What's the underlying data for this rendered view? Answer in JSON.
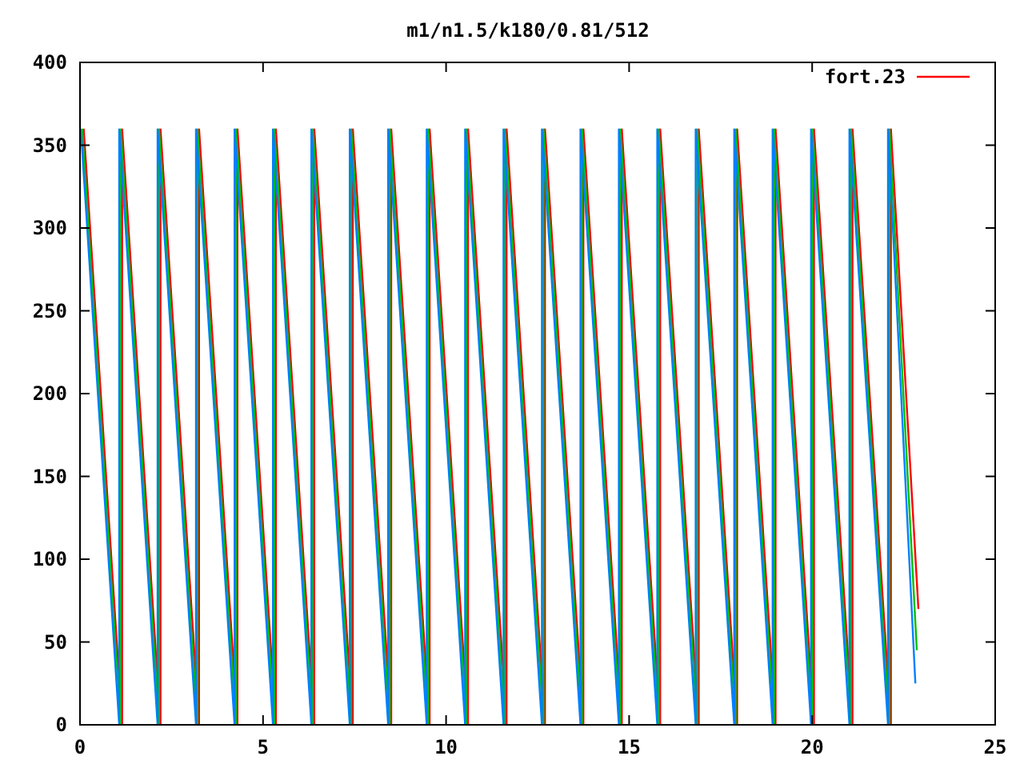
{
  "chart_data": {
    "type": "line",
    "title": "m1/n1.5/k180/0.81/512",
    "xlim": [
      0,
      25
    ],
    "ylim": [
      0,
      400
    ],
    "xticks": [
      0,
      5,
      10,
      15,
      20,
      25
    ],
    "yticks": [
      0,
      50,
      100,
      150,
      200,
      250,
      300,
      350,
      400
    ],
    "series": [
      {
        "name": "fort.23",
        "color": "#ff0000",
        "x": [
          0.1,
          1.15,
          1.15,
          2.2,
          2.2,
          3.25,
          3.25,
          4.3,
          4.3,
          5.35,
          5.35,
          6.4,
          6.4,
          7.45,
          7.45,
          8.5,
          8.5,
          9.55,
          9.55,
          10.6,
          10.6,
          11.65,
          11.65,
          12.7,
          12.7,
          13.75,
          13.75,
          14.8,
          14.8,
          15.85,
          15.85,
          16.9,
          16.9,
          17.95,
          17.95,
          19.0,
          19.0,
          20.05,
          20.05,
          21.1,
          21.1,
          22.15,
          22.15,
          22.9
        ],
        "values": [
          360,
          0,
          360,
          0,
          360,
          0,
          360,
          0,
          360,
          0,
          360,
          0,
          360,
          0,
          360,
          0,
          360,
          0,
          360,
          0,
          360,
          0,
          360,
          0,
          360,
          0,
          360,
          0,
          360,
          0,
          360,
          0,
          360,
          0,
          360,
          0,
          360,
          0,
          360,
          0,
          360,
          0,
          360,
          70
        ]
      },
      {
        "color": "#00c000",
        "x": [
          0.06,
          1.11,
          1.11,
          2.16,
          2.16,
          3.21,
          3.21,
          4.26,
          4.26,
          5.31,
          5.31,
          6.36,
          6.36,
          7.41,
          7.41,
          8.46,
          8.46,
          9.51,
          9.51,
          10.56,
          10.56,
          11.61,
          11.61,
          12.66,
          12.66,
          13.71,
          13.71,
          14.76,
          14.76,
          15.81,
          15.81,
          16.86,
          16.86,
          17.91,
          17.91,
          18.96,
          18.96,
          20.01,
          20.01,
          21.06,
          21.06,
          22.11,
          22.11,
          22.86
        ],
        "values": [
          360,
          0,
          360,
          0,
          360,
          0,
          360,
          0,
          360,
          0,
          360,
          0,
          360,
          0,
          360,
          0,
          360,
          0,
          360,
          0,
          360,
          0,
          360,
          0,
          360,
          0,
          360,
          0,
          360,
          0,
          360,
          0,
          360,
          0,
          360,
          0,
          360,
          0,
          360,
          0,
          360,
          0,
          360,
          45
        ]
      },
      {
        "color": "#0080ff",
        "x": [
          0.02,
          1.07,
          1.07,
          2.12,
          2.12,
          3.17,
          3.17,
          4.22,
          4.22,
          5.27,
          5.27,
          6.32,
          6.32,
          7.37,
          7.37,
          8.42,
          8.42,
          9.47,
          9.47,
          10.52,
          10.52,
          11.57,
          11.57,
          12.62,
          12.62,
          13.67,
          13.67,
          14.72,
          14.72,
          15.77,
          15.77,
          16.82,
          16.82,
          17.87,
          17.87,
          18.92,
          18.92,
          19.97,
          19.97,
          21.02,
          21.02,
          22.07,
          22.07,
          22.82
        ],
        "values": [
          360,
          0,
          360,
          0,
          360,
          0,
          360,
          0,
          360,
          0,
          360,
          0,
          360,
          0,
          360,
          0,
          360,
          0,
          360,
          0,
          360,
          0,
          360,
          0,
          360,
          0,
          360,
          0,
          360,
          0,
          360,
          0,
          360,
          0,
          360,
          0,
          360,
          0,
          360,
          0,
          360,
          0,
          360,
          25
        ]
      }
    ]
  }
}
